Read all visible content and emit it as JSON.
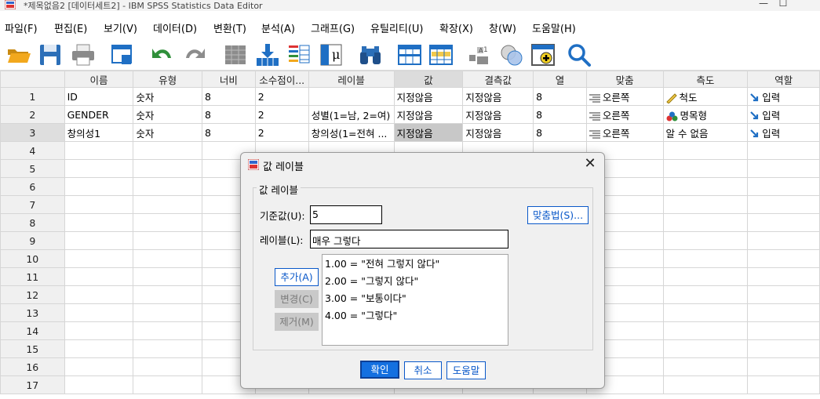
{
  "window": {
    "title": "*제목없음2 [데이터세트2] - IBM SPSS Statistics Data Editor",
    "minimize": "—",
    "maximize": "☐"
  },
  "menu": [
    "파일(F)",
    "편집(E)",
    "보기(V)",
    "데이터(D)",
    "변환(T)",
    "분석(A)",
    "그래프(G)",
    "유틸리티(U)",
    "확장(X)",
    "창(W)",
    "도움말(H)"
  ],
  "toolbar_icons": [
    "open-folder",
    "save",
    "print",
    "dialog-recall",
    "undo",
    "redo",
    "goto-case",
    "goto-variable",
    "variables",
    "run-descriptives",
    "find",
    "split-file",
    "select-cases",
    "value-labels",
    "use-variable-sets",
    "spelling",
    "search"
  ],
  "grid": {
    "columns": [
      "이름",
      "유형",
      "너비",
      "소수점이...",
      "레이블",
      "값",
      "결측값",
      "열",
      "맞춤",
      "측도",
      "역할"
    ],
    "selected_column": "값",
    "rows": [
      {
        "num": "1",
        "name": "ID",
        "type": "숫자",
        "width": "8",
        "decimals": "2",
        "label": "",
        "values": "지정않음",
        "missing": "지정않음",
        "columns": "8",
        "align": "오른쪽",
        "measure": "척도",
        "measure_icon": "ruler-icon",
        "role": "입력"
      },
      {
        "num": "2",
        "name": "GENDER",
        "type": "숫자",
        "width": "8",
        "decimals": "2",
        "label": "성별(1=남, 2=여)",
        "values": "지정않음",
        "missing": "지정않음",
        "columns": "8",
        "align": "오른쪽",
        "measure": "명목형",
        "measure_icon": "nominal-icon",
        "role": "입력"
      },
      {
        "num": "3",
        "name": "창의성1",
        "type": "숫자",
        "width": "8",
        "decimals": "2",
        "label": "창의성(1=전혀 ...",
        "values": "지정않음",
        "missing": "지정않음",
        "columns": "8",
        "align": "오른쪽",
        "measure": "알 수 없음",
        "measure_icon": "",
        "role": "입력"
      }
    ],
    "empty_rows": [
      "4",
      "5",
      "6",
      "7",
      "8",
      "9",
      "10",
      "11",
      "12",
      "13",
      "14",
      "15",
      "16",
      "17"
    ]
  },
  "dialog": {
    "title": "값 레이블",
    "group_label": "값 레이블",
    "value_label": "기준값(U):",
    "value": "5",
    "label_label": "레이블(L):",
    "label": "매우 그렇다",
    "spelling_button": "맞춤법(S)...",
    "add_button": "추가(A)",
    "change_button": "변경(C)",
    "remove_button": "제거(M)",
    "list": [
      "1.00 = \"전혀 그렇지 않다\"",
      "2.00 = \"그렇지 않다\"",
      "3.00 = \"보통이다\"",
      "4.00 = \"그렇다\""
    ],
    "ok_button": "확인",
    "cancel_button": "취소",
    "help_button": "도움말"
  },
  "colors": {
    "accent": "#0a58c9",
    "primary_button": "#1470e0",
    "toolbar_blue": "#1f6fc4",
    "toolbar_green": "#2f8f3a"
  }
}
